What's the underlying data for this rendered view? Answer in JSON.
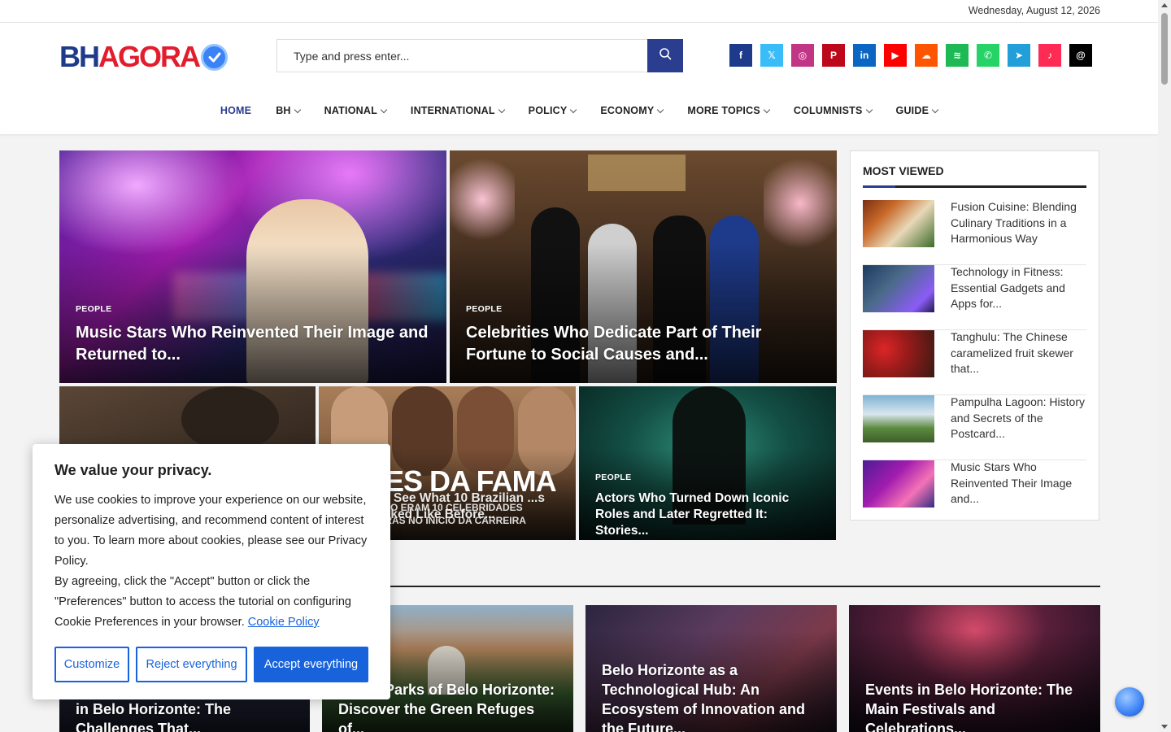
{
  "topbar": {
    "date": "Wednesday, August 12, 2026"
  },
  "header": {
    "logo": {
      "part1": "BH",
      "part2": "AGORA",
      "badge_icon": "check-badge-icon"
    },
    "search": {
      "placeholder": "Type and press enter...",
      "button_icon": "search-icon"
    },
    "socials": [
      {
        "name": "facebook",
        "glyph": "f",
        "color": "#1e3a8a"
      },
      {
        "name": "x",
        "glyph": "𝕏",
        "color": "#38bdf8"
      },
      {
        "name": "instagram",
        "glyph": "◎",
        "color": "#c13584"
      },
      {
        "name": "pinterest",
        "glyph": "P",
        "color": "#bd081c"
      },
      {
        "name": "linkedin",
        "glyph": "in",
        "color": "#0a66c2"
      },
      {
        "name": "youtube",
        "glyph": "▶",
        "color": "#ff0000"
      },
      {
        "name": "soundcloud",
        "glyph": "☁",
        "color": "#ff5500"
      },
      {
        "name": "spotify",
        "glyph": "≋",
        "color": "#1db954"
      },
      {
        "name": "whatsapp",
        "glyph": "✆",
        "color": "#25d366"
      },
      {
        "name": "telegram",
        "glyph": "➤",
        "color": "#229ed9"
      },
      {
        "name": "tiktok",
        "glyph": "♪",
        "color": "#fe2c55"
      },
      {
        "name": "threads",
        "glyph": "@",
        "color": "#000000"
      }
    ]
  },
  "nav": {
    "items": [
      {
        "label": "HOME",
        "active": true,
        "dropdown": false
      },
      {
        "label": "BH",
        "active": false,
        "dropdown": true
      },
      {
        "label": "NATIONAL",
        "active": false,
        "dropdown": true
      },
      {
        "label": "INTERNATIONAL",
        "active": false,
        "dropdown": true
      },
      {
        "label": "POLICY",
        "active": false,
        "dropdown": true
      },
      {
        "label": "ECONOMY",
        "active": false,
        "dropdown": true
      },
      {
        "label": "MORE TOPICS",
        "active": false,
        "dropdown": true
      },
      {
        "label": "COLUMNISTS",
        "active": false,
        "dropdown": true
      },
      {
        "label": "GUIDE",
        "active": false,
        "dropdown": true
      }
    ]
  },
  "featured": {
    "big": [
      {
        "category": "PEOPLE",
        "title": "Music Stars Who Reinvented Their Image and Returned to..."
      },
      {
        "category": "PEOPLE",
        "title": "Celebrities Who Dedicate Part of Their Fortune to Social Causes and..."
      }
    ],
    "small": [
      {
        "category": "",
        "title": ""
      },
      {
        "category": "",
        "title": "me: See What 10 Brazilian ...s Looked Like Before...",
        "overlay_text": "TES DA FAMA",
        "overlay_sub": "COMO ERAM 10 CELEBRIDADES ...EIRAS NO INICIO DA CARREIRA"
      },
      {
        "category": "PEOPLE",
        "title": "Actors Who Turned Down Iconic Roles and Later Regretted It: Stories..."
      }
    ]
  },
  "sidebar": {
    "heading": "MOST VIEWED",
    "items": [
      {
        "title": "Fusion Cuisine: Blending Culinary Traditions in a Harmonious Way"
      },
      {
        "title": "Technology in Fitness: Essential Gadgets and Apps for..."
      },
      {
        "title": "Tanghulu: The Chinese caramelized fruit skewer that..."
      },
      {
        "title": "Pampulha Lagoon: History and Secrets of the Postcard..."
      },
      {
        "title": "Music Stars Who Reinvented Their Image and..."
      }
    ]
  },
  "lower": [
    {
      "title": "in Belo Horizonte: The Challenges That..."
    },
    {
      "title": "Urban Parks of Belo Horizonte: Discover the Green Refuges of..."
    },
    {
      "title": "Belo Horizonte as a Technological Hub: An Ecosystem of Innovation and the Future..."
    },
    {
      "title": "Events in Belo Horizonte: The Main Festivals and Celebrations..."
    }
  ],
  "cookie": {
    "title": "We value your privacy.",
    "p1": "We use cookies to improve your experience on our website, personalize advertising, and recommend content of interest to you. To learn more about cookies, please see our Privacy Policy.",
    "p2": "By agreeing, click the \"Accept\" button or click the \"Preferences\" button to access the tutorial on configuring Cookie Preferences in your browser.",
    "link": "Cookie Policy",
    "buttons": {
      "customize": "Customize",
      "reject": "Reject everything",
      "accept": "Accept everything"
    }
  },
  "colors": {
    "brand_blue": "#2a3d8f",
    "brand_red": "#e11d2e",
    "cookie_blue": "#1863dc"
  }
}
